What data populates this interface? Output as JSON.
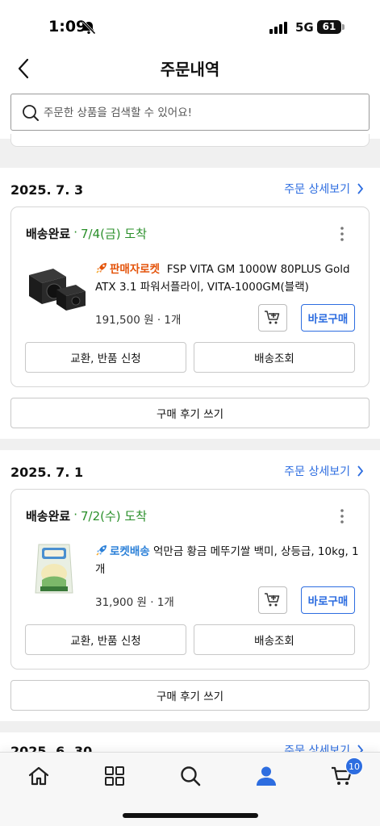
{
  "status_bar": {
    "time": "1:09",
    "network": "5G",
    "battery": "61"
  },
  "header": {
    "title": "주문내역"
  },
  "search": {
    "placeholder": "주문한 상품을 검색할 수 있어요!"
  },
  "orders": [
    {
      "date": "2025. 7. 3",
      "detail_label": "주문 상세보기",
      "status": "배송완료",
      "separator": "·",
      "arrival": "7/4(금) 도착",
      "product": {
        "badge": "판매자로켓",
        "name": "FSP VITA GM 1000W 80PLUS Gold ATX 3.1 파워서플라이, VITA-1000GM(블랙)",
        "price_qty": "191,500 원 · 1개"
      },
      "buy_label": "바로구매",
      "exchange_label": "교환, 반품 신청",
      "tracking_label": "배송조회",
      "review_label": "구매 후기 쓰기"
    },
    {
      "date": "2025. 7. 1",
      "detail_label": "주문 상세보기",
      "status": "배송완료",
      "separator": "·",
      "arrival": "7/2(수) 도착",
      "product": {
        "badge": "로켓배송",
        "name": "억만금 황금 메뚜기쌀 백미, 상등급, 10kg, 1개",
        "price_qty": "31,900 원 · 1개"
      },
      "buy_label": "바로구매",
      "exchange_label": "교환, 반품 신청",
      "tracking_label": "배송조회",
      "review_label": "구매 후기 쓰기"
    },
    {
      "date": "2025. 6. 30",
      "detail_label": "주문 상세보기"
    }
  ],
  "bottom_nav": {
    "items": [
      "home-icon",
      "categories-icon",
      "search-icon",
      "my-page-icon",
      "cart-icon"
    ],
    "cart_count": "10",
    "active_color": "#2d6de0"
  },
  "colors": {
    "accent": "#2d6de0",
    "delivered_green": "#2a8f2a",
    "seller_rocket": "#e4540b",
    "rocket": "#2b80d8"
  }
}
